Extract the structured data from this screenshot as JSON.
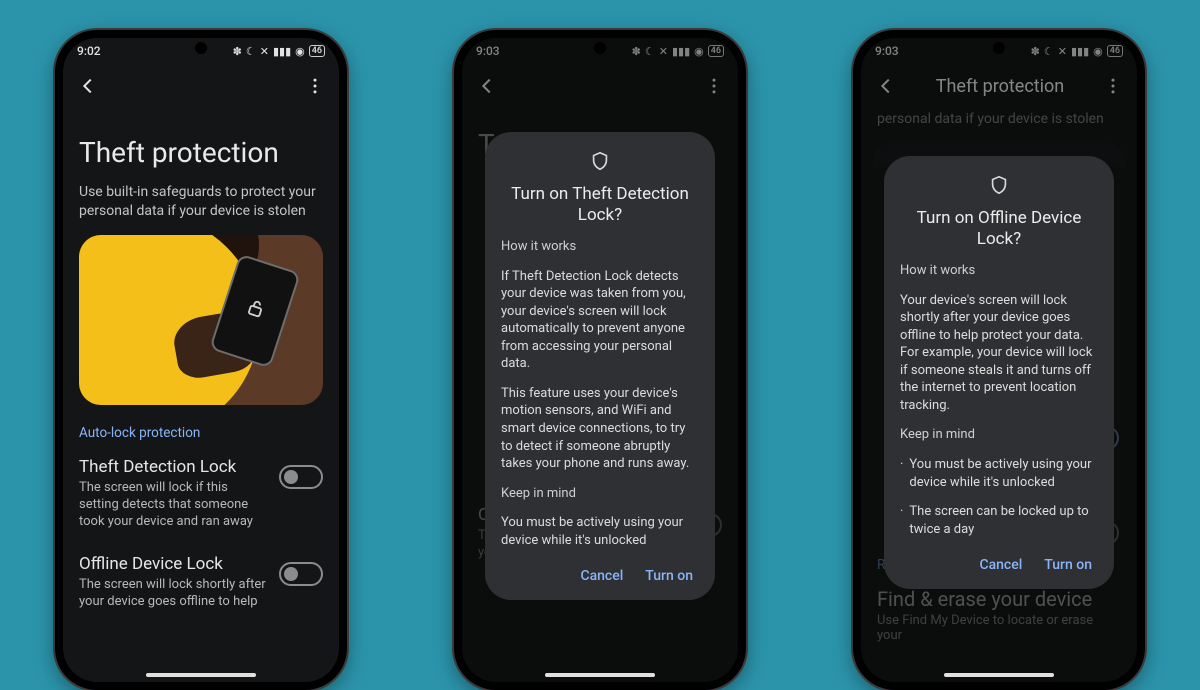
{
  "accent": "#8ab4f8",
  "phones": [
    {
      "time": "9:02",
      "battery": "46",
      "page_title": "Theft protection",
      "subtitle": "Use built-in safeguards to protect your personal data if your device is stolen",
      "section_label": "Auto-lock protection",
      "settings": [
        {
          "name": "Theft Detection Lock",
          "desc": "The screen will lock if this setting detects that someone took your device and ran away",
          "on": false
        },
        {
          "name": "Offline Device Lock",
          "desc": "The screen will lock shortly after your device goes offline to help",
          "on": false
        }
      ]
    },
    {
      "time": "9:03",
      "battery": "46",
      "bg_settings": [
        {
          "name": "Offline Device Lock",
          "desc": "The screen will lock shortly after your device goes offline to help",
          "on": false
        }
      ],
      "dialog": {
        "title": "Turn on Theft Detection Lock?",
        "how": "How it works",
        "p1": "If Theft Detection Lock detects your device was taken from you, your device's screen will lock automatically to prevent anyone from accessing your personal data.",
        "p2": "This feature uses your device's motion sensors, and WiFi and smart device connections, to try to detect if someone abruptly takes your phone and runs away.",
        "keep": "Keep in mind",
        "p3": "You must be actively using your device while it's unlocked",
        "cancel": "Cancel",
        "confirm": "Turn on"
      }
    },
    {
      "time": "9:03",
      "battery": "46",
      "appbar_title": "Theft protection",
      "bg_subtitle_partial": "personal data if your device is stolen",
      "remotely_label": "Remotely secure device",
      "find_title": "Find & erase your device",
      "find_desc": "Use Find My Device to locate or erase your",
      "dialog": {
        "title": "Turn on Offline Device Lock?",
        "how": "How it works",
        "p1": "Your device's screen will lock shortly after your device goes offline to help protect your data. For example, your device will lock if someone steals it and turns off the internet to prevent location tracking.",
        "keep": "Keep in mind",
        "b1": "You must be actively using your device while it's unlocked",
        "b2": "The screen can be locked up to twice a day",
        "cancel": "Cancel",
        "confirm": "Turn on"
      }
    }
  ]
}
